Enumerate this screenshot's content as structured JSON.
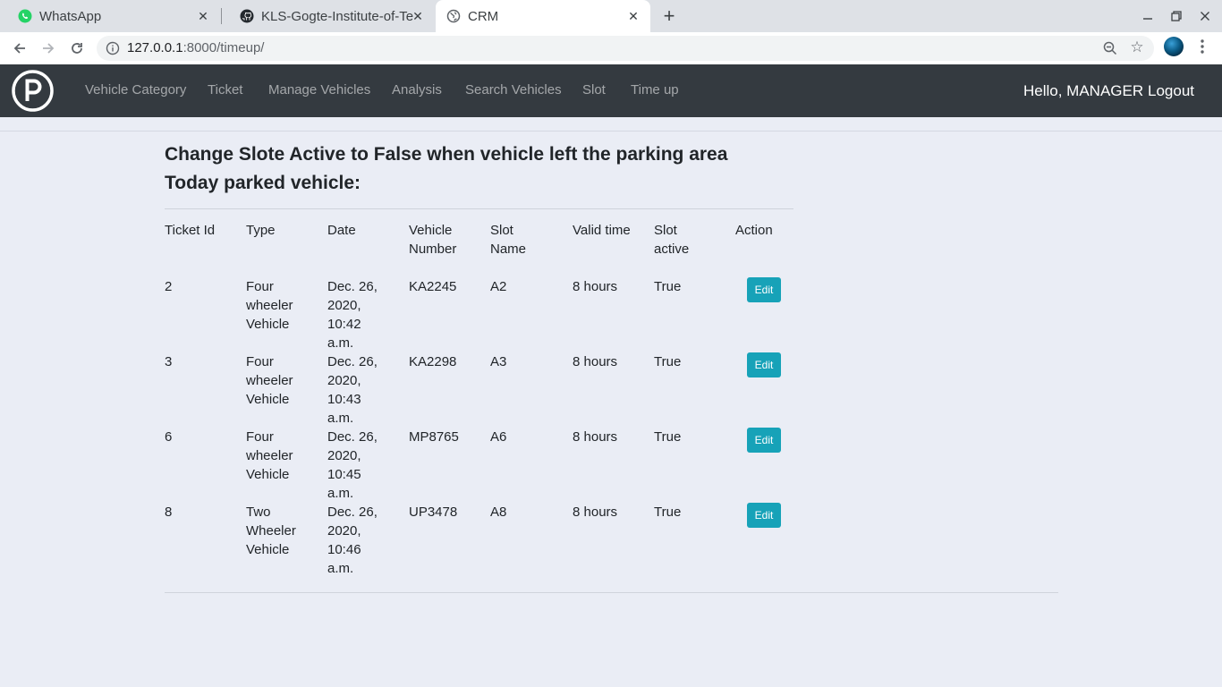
{
  "browser": {
    "tabs": [
      {
        "title": "WhatsApp",
        "icon": "whatsapp-icon"
      },
      {
        "title": "KLS-Gogte-Institute-of-Te",
        "icon": "github-icon"
      },
      {
        "title": "CRM",
        "icon": "globe-icon"
      }
    ],
    "url_host": "127.0.0.1",
    "url_path": ":8000/timeup/"
  },
  "navbar": {
    "links": [
      "Vehicle Category",
      "Ticket",
      "Manage Vehicles",
      "Analysis",
      "Search Vehicles",
      "Slot",
      "Time up"
    ],
    "greeting": "Hello, MANAGER",
    "logout": "Logout"
  },
  "page": {
    "heading1": "Change Slote Active to False when vehicle left the parking area",
    "heading2": "Today parked vehicle:"
  },
  "table": {
    "headers": {
      "ticket_id": "Ticket Id",
      "type": "Type",
      "date": "Date",
      "vehicle_number": [
        "Vehicle",
        "Number"
      ],
      "slot_name": [
        "Slot",
        "Name"
      ],
      "valid_time": "Valid time",
      "slot_active": [
        "Slot",
        "active"
      ],
      "action": "Action"
    },
    "rows": [
      {
        "ticket_id": "2",
        "type": [
          "Four",
          "wheeler",
          "Vehicle"
        ],
        "date": [
          "Dec. 26,",
          "2020,",
          "10:42",
          "a.m."
        ],
        "vehicle_number": "KA2245",
        "slot_name": "A2",
        "valid_time": "8 hours",
        "slot_active": "True",
        "action": "Edit"
      },
      {
        "ticket_id": "3",
        "type": [
          "Four",
          "wheeler",
          "Vehicle"
        ],
        "date": [
          "Dec. 26,",
          "2020,",
          "10:43",
          "a.m."
        ],
        "vehicle_number": "KA2298",
        "slot_name": "A3",
        "valid_time": "8 hours",
        "slot_active": "True",
        "action": "Edit"
      },
      {
        "ticket_id": "6",
        "type": [
          "Four",
          "wheeler",
          "Vehicle"
        ],
        "date": [
          "Dec. 26,",
          "2020,",
          "10:45",
          "a.m."
        ],
        "vehicle_number": "MP8765",
        "slot_name": "A6",
        "valid_time": "8 hours",
        "slot_active": "True",
        "action": "Edit"
      },
      {
        "ticket_id": "8",
        "type": [
          "Two",
          "Wheeler",
          "Vehicle"
        ],
        "date": [
          "Dec. 26,",
          "2020,",
          "10:46",
          "a.m."
        ],
        "vehicle_number": "UP3478",
        "slot_name": "A8",
        "valid_time": "8 hours",
        "slot_active": "True",
        "action": "Edit"
      }
    ]
  },
  "colors": {
    "navbar_bg": "#343a40",
    "page_bg": "#eaedf5",
    "edit_button": "#17a2b8"
  }
}
